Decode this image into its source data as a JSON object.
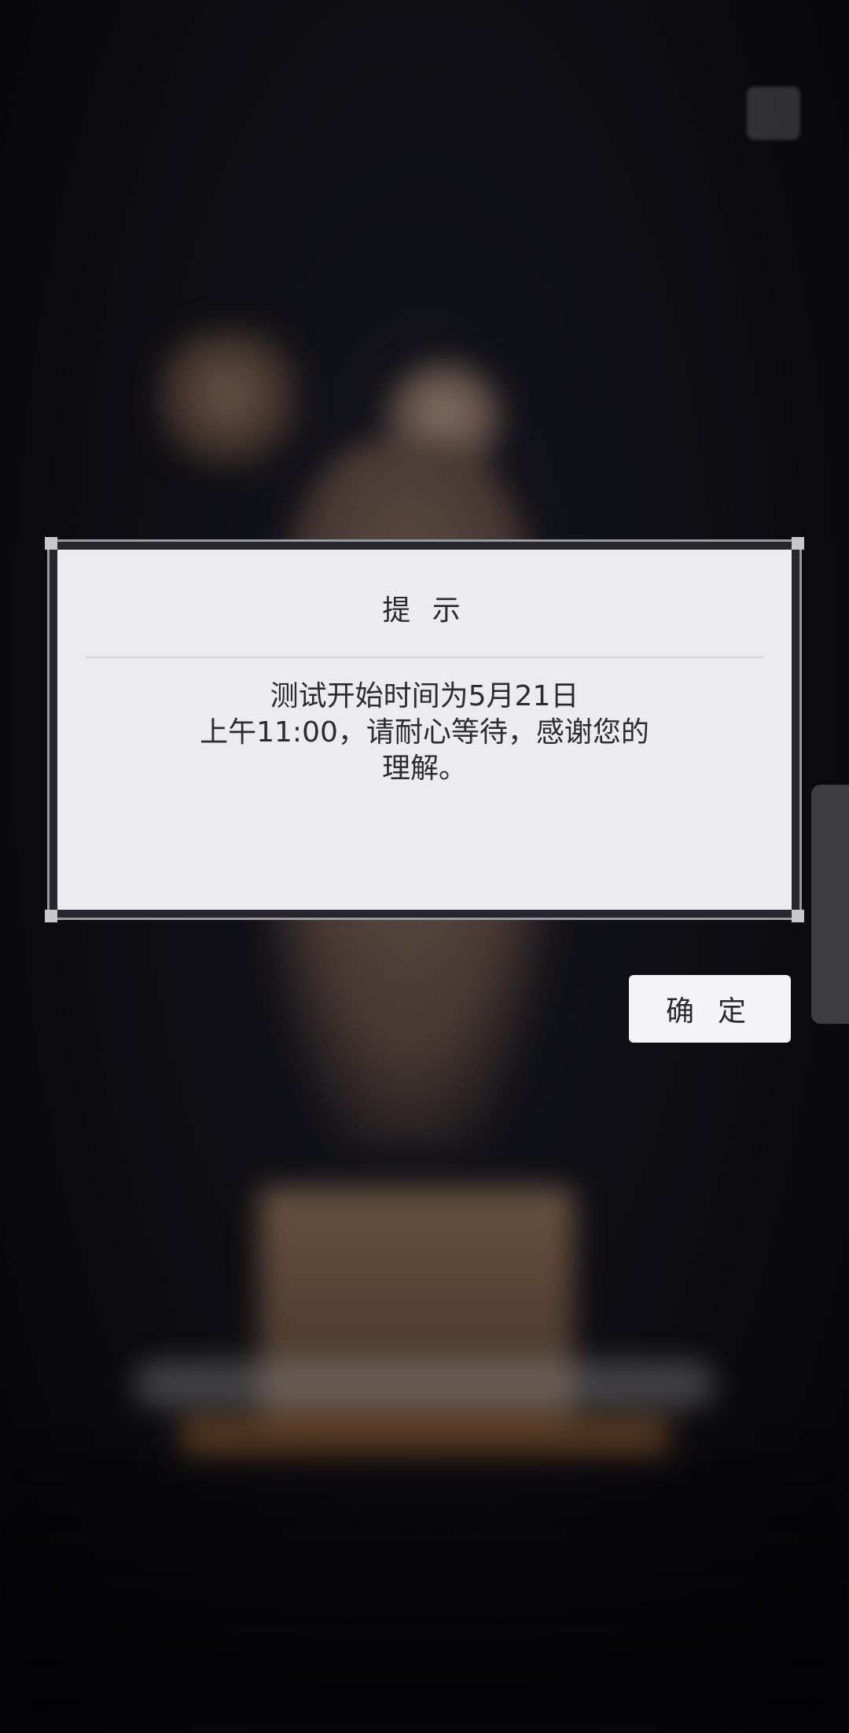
{
  "dialog": {
    "title": "提 示",
    "message_line1": "测试开始时间为5月21日",
    "message_line2": "上午11:00，请耐心等待，感谢您的",
    "message_line3": "理解。"
  },
  "confirm_button": {
    "label": "确 定"
  },
  "colors": {
    "dialog_background": "#ececf0",
    "dialog_frame": "#9a9aa2",
    "button_background": "#f4f4f6",
    "screen_background": "#0b0b0e"
  }
}
